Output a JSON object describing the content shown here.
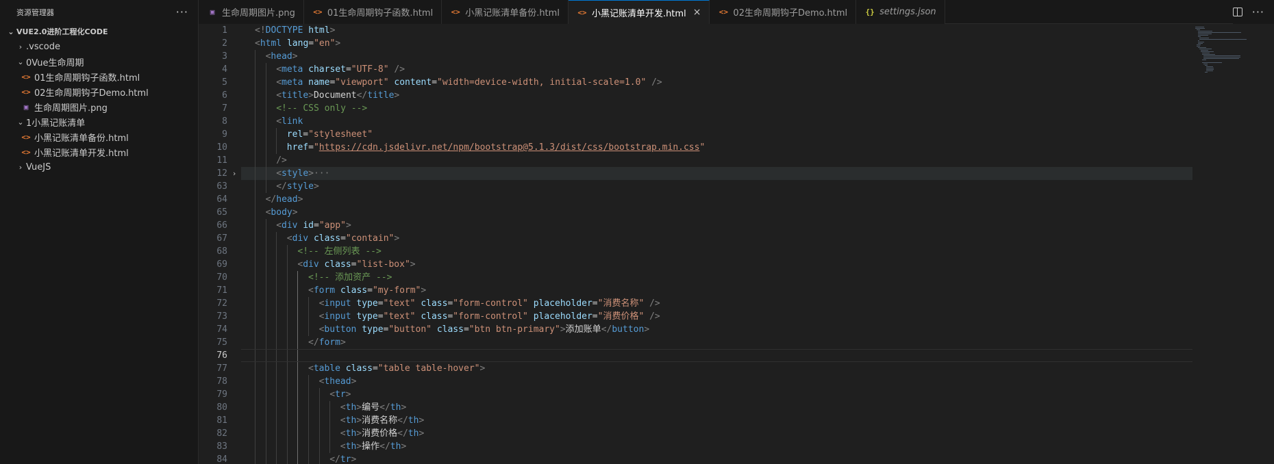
{
  "sidebar": {
    "title": "资源管理器",
    "more": "···",
    "root": "VUE2.0进阶工程化CODE",
    "tree": [
      {
        "label": ".vscode",
        "type": "folder",
        "open": false,
        "depth": 1
      },
      {
        "label": "0Vue生命周期",
        "type": "folder",
        "open": true,
        "depth": 1
      },
      {
        "label": "01生命周期钩子函数.html",
        "type": "html",
        "depth": 2
      },
      {
        "label": "02生命周期钩子Demo.html",
        "type": "html",
        "depth": 2
      },
      {
        "label": "生命周期图片.png",
        "type": "png",
        "depth": 2
      },
      {
        "label": "1小黑记账清单",
        "type": "folder",
        "open": true,
        "depth": 1
      },
      {
        "label": "小黑记账清单备份.html",
        "type": "html",
        "depth": 2
      },
      {
        "label": "小黑记账清单开发.html",
        "type": "html",
        "depth": 2
      },
      {
        "label": "VueJS",
        "type": "folder",
        "open": false,
        "depth": 1
      }
    ]
  },
  "tabs": [
    {
      "label": "生命周期图片.png",
      "type": "png"
    },
    {
      "label": "01生命周期钩子函数.html",
      "type": "html"
    },
    {
      "label": "小黑记账清单备份.html",
      "type": "html"
    },
    {
      "label": "小黑记账清单开发.html",
      "type": "html",
      "active": true,
      "close": "×"
    },
    {
      "label": "02生命周期钩子Demo.html",
      "type": "html"
    },
    {
      "label": "settings.json",
      "type": "json",
      "italic": true
    }
  ],
  "icons": {
    "html_glyph": "<>",
    "json_glyph": "{}",
    "png_glyph": "▣",
    "chevron_right": "›",
    "chevron_down": "⌄"
  },
  "editor": {
    "current_line": 76,
    "lines": [
      {
        "n": 1,
        "indent": 0,
        "tokens": [
          [
            "tg",
            "<!"
          ],
          [
            "tn",
            "DOCTYPE"
          ],
          [
            "tx",
            " "
          ],
          [
            "at",
            "html"
          ],
          [
            "tg",
            ">"
          ]
        ]
      },
      {
        "n": 2,
        "indent": 0,
        "tokens": [
          [
            "tg",
            "<"
          ],
          [
            "tn",
            "html"
          ],
          [
            "tx",
            " "
          ],
          [
            "at",
            "lang"
          ],
          [
            "tx",
            "="
          ],
          [
            "sv",
            "\"en\""
          ],
          [
            "tg",
            ">"
          ]
        ]
      },
      {
        "n": 3,
        "indent": 1,
        "tokens": [
          [
            "tg",
            "<"
          ],
          [
            "tn",
            "head"
          ],
          [
            "tg",
            ">"
          ]
        ]
      },
      {
        "n": 4,
        "indent": 2,
        "tokens": [
          [
            "tg",
            "<"
          ],
          [
            "tn",
            "meta"
          ],
          [
            "tx",
            " "
          ],
          [
            "at",
            "charset"
          ],
          [
            "tx",
            "="
          ],
          [
            "sv",
            "\"UTF-8\""
          ],
          [
            "tx",
            " "
          ],
          [
            "tg",
            "/>"
          ]
        ]
      },
      {
        "n": 5,
        "indent": 2,
        "tokens": [
          [
            "tg",
            "<"
          ],
          [
            "tn",
            "meta"
          ],
          [
            "tx",
            " "
          ],
          [
            "at",
            "name"
          ],
          [
            "tx",
            "="
          ],
          [
            "sv",
            "\"viewport\""
          ],
          [
            "tx",
            " "
          ],
          [
            "at",
            "content"
          ],
          [
            "tx",
            "="
          ],
          [
            "sv",
            "\"width=device-width, initial-scale=1.0\""
          ],
          [
            "tx",
            " "
          ],
          [
            "tg",
            "/>"
          ]
        ]
      },
      {
        "n": 6,
        "indent": 2,
        "tokens": [
          [
            "tg",
            "<"
          ],
          [
            "tn",
            "title"
          ],
          [
            "tg",
            ">"
          ],
          [
            "tx",
            "Document"
          ],
          [
            "tg",
            "</"
          ],
          [
            "tn",
            "title"
          ],
          [
            "tg",
            ">"
          ]
        ]
      },
      {
        "n": 7,
        "indent": 2,
        "tokens": [
          [
            "cm",
            "<!-- CSS only -->"
          ]
        ]
      },
      {
        "n": 8,
        "indent": 2,
        "tokens": [
          [
            "tg",
            "<"
          ],
          [
            "tn",
            "link"
          ]
        ]
      },
      {
        "n": 9,
        "indent": 3,
        "tokens": [
          [
            "at",
            "rel"
          ],
          [
            "tx",
            "="
          ],
          [
            "sv",
            "\"stylesheet\""
          ]
        ]
      },
      {
        "n": 10,
        "indent": 3,
        "tokens": [
          [
            "at",
            "href"
          ],
          [
            "tx",
            "="
          ],
          [
            "sv",
            "\""
          ],
          [
            "lk",
            "https://cdn.jsdelivr.net/npm/bootstrap@5.1.3/dist/css/bootstrap.min.css"
          ],
          [
            "sv",
            "\""
          ]
        ]
      },
      {
        "n": 11,
        "indent": 2,
        "tokens": [
          [
            "tg",
            "/>"
          ]
        ]
      },
      {
        "n": 12,
        "indent": 2,
        "fold": "›",
        "hl": true,
        "tokens": [
          [
            "tg",
            "<"
          ],
          [
            "tn",
            "style"
          ],
          [
            "tg",
            ">"
          ],
          [
            "ellip",
            "···"
          ]
        ]
      },
      {
        "n": 63,
        "indent": 2,
        "tokens": [
          [
            "tg",
            "</"
          ],
          [
            "tn",
            "style"
          ],
          [
            "tg",
            ">"
          ]
        ]
      },
      {
        "n": 64,
        "indent": 1,
        "tokens": [
          [
            "tg",
            "</"
          ],
          [
            "tn",
            "head"
          ],
          [
            "tg",
            ">"
          ]
        ]
      },
      {
        "n": 65,
        "indent": 1,
        "tokens": [
          [
            "tg",
            "<"
          ],
          [
            "tn",
            "body"
          ],
          [
            "tg",
            ">"
          ]
        ]
      },
      {
        "n": 66,
        "indent": 2,
        "tokens": [
          [
            "tg",
            "<"
          ],
          [
            "tn",
            "div"
          ],
          [
            "tx",
            " "
          ],
          [
            "at",
            "id"
          ],
          [
            "tx",
            "="
          ],
          [
            "sv",
            "\"app\""
          ],
          [
            "tg",
            ">"
          ]
        ]
      },
      {
        "n": 67,
        "indent": 3,
        "tokens": [
          [
            "tg",
            "<"
          ],
          [
            "tn",
            "div"
          ],
          [
            "tx",
            " "
          ],
          [
            "at",
            "class"
          ],
          [
            "tx",
            "="
          ],
          [
            "sv",
            "\"contain\""
          ],
          [
            "tg",
            ">"
          ]
        ]
      },
      {
        "n": 68,
        "indent": 4,
        "tokens": [
          [
            "cm",
            "<!-- 左侧列表 -->"
          ]
        ]
      },
      {
        "n": 69,
        "indent": 4,
        "tokens": [
          [
            "tg",
            "<"
          ],
          [
            "tn",
            "div"
          ],
          [
            "tx",
            " "
          ],
          [
            "at",
            "class"
          ],
          [
            "tx",
            "="
          ],
          [
            "sv",
            "\"list-box\""
          ],
          [
            "tg",
            ">"
          ]
        ]
      },
      {
        "n": 70,
        "indent": 5,
        "tokens": [
          [
            "cm",
            "<!-- 添加资产 -->"
          ]
        ]
      },
      {
        "n": 71,
        "indent": 5,
        "tokens": [
          [
            "tg",
            "<"
          ],
          [
            "tn",
            "form"
          ],
          [
            "tx",
            " "
          ],
          [
            "at",
            "class"
          ],
          [
            "tx",
            "="
          ],
          [
            "sv",
            "\"my-form\""
          ],
          [
            "tg",
            ">"
          ]
        ]
      },
      {
        "n": 72,
        "indent": 6,
        "tokens": [
          [
            "tg",
            "<"
          ],
          [
            "tn",
            "input"
          ],
          [
            "tx",
            " "
          ],
          [
            "at",
            "type"
          ],
          [
            "tx",
            "="
          ],
          [
            "sv",
            "\"text\""
          ],
          [
            "tx",
            " "
          ],
          [
            "at",
            "class"
          ],
          [
            "tx",
            "="
          ],
          [
            "sv",
            "\"form-control\""
          ],
          [
            "tx",
            " "
          ],
          [
            "at",
            "placeholder"
          ],
          [
            "tx",
            "="
          ],
          [
            "sv",
            "\"消费名称\""
          ],
          [
            "tx",
            " "
          ],
          [
            "tg",
            "/>"
          ]
        ]
      },
      {
        "n": 73,
        "indent": 6,
        "tokens": [
          [
            "tg",
            "<"
          ],
          [
            "tn",
            "input"
          ],
          [
            "tx",
            " "
          ],
          [
            "at",
            "type"
          ],
          [
            "tx",
            "="
          ],
          [
            "sv",
            "\"text\""
          ],
          [
            "tx",
            " "
          ],
          [
            "at",
            "class"
          ],
          [
            "tx",
            "="
          ],
          [
            "sv",
            "\"form-control\""
          ],
          [
            "tx",
            " "
          ],
          [
            "at",
            "placeholder"
          ],
          [
            "tx",
            "="
          ],
          [
            "sv",
            "\"消费价格\""
          ],
          [
            "tx",
            " "
          ],
          [
            "tg",
            "/>"
          ]
        ]
      },
      {
        "n": 74,
        "indent": 6,
        "tokens": [
          [
            "tg",
            "<"
          ],
          [
            "tn",
            "button"
          ],
          [
            "tx",
            " "
          ],
          [
            "at",
            "type"
          ],
          [
            "tx",
            "="
          ],
          [
            "sv",
            "\"button\""
          ],
          [
            "tx",
            " "
          ],
          [
            "at",
            "class"
          ],
          [
            "tx",
            "="
          ],
          [
            "sv",
            "\"btn btn-primary\""
          ],
          [
            "tg",
            ">"
          ],
          [
            "tx",
            "添加账单"
          ],
          [
            "tg",
            "</"
          ],
          [
            "tn",
            "button"
          ],
          [
            "tg",
            ">"
          ]
        ]
      },
      {
        "n": 75,
        "indent": 5,
        "tokens": [
          [
            "tg",
            "</"
          ],
          [
            "tn",
            "form"
          ],
          [
            "tg",
            ">"
          ]
        ]
      },
      {
        "n": 76,
        "indent": 0,
        "cur": true,
        "tokens": []
      },
      {
        "n": 77,
        "indent": 5,
        "tokens": [
          [
            "tg",
            "<"
          ],
          [
            "tn",
            "table"
          ],
          [
            "tx",
            " "
          ],
          [
            "at",
            "class"
          ],
          [
            "tx",
            "="
          ],
          [
            "sv",
            "\"table table-hover\""
          ],
          [
            "tg",
            ">"
          ]
        ]
      },
      {
        "n": 78,
        "indent": 6,
        "tokens": [
          [
            "tg",
            "<"
          ],
          [
            "tn",
            "thead"
          ],
          [
            "tg",
            ">"
          ]
        ]
      },
      {
        "n": 79,
        "indent": 7,
        "tokens": [
          [
            "tg",
            "<"
          ],
          [
            "tn",
            "tr"
          ],
          [
            "tg",
            ">"
          ]
        ]
      },
      {
        "n": 80,
        "indent": 8,
        "tokens": [
          [
            "tg",
            "<"
          ],
          [
            "tn",
            "th"
          ],
          [
            "tg",
            ">"
          ],
          [
            "tx",
            "编号"
          ],
          [
            "tg",
            "</"
          ],
          [
            "tn",
            "th"
          ],
          [
            "tg",
            ">"
          ]
        ]
      },
      {
        "n": 81,
        "indent": 8,
        "tokens": [
          [
            "tg",
            "<"
          ],
          [
            "tn",
            "th"
          ],
          [
            "tg",
            ">"
          ],
          [
            "tx",
            "消费名称"
          ],
          [
            "tg",
            "</"
          ],
          [
            "tn",
            "th"
          ],
          [
            "tg",
            ">"
          ]
        ]
      },
      {
        "n": 82,
        "indent": 8,
        "tokens": [
          [
            "tg",
            "<"
          ],
          [
            "tn",
            "th"
          ],
          [
            "tg",
            ">"
          ],
          [
            "tx",
            "消费价格"
          ],
          [
            "tg",
            "</"
          ],
          [
            "tn",
            "th"
          ],
          [
            "tg",
            ">"
          ]
        ]
      },
      {
        "n": 83,
        "indent": 8,
        "tokens": [
          [
            "tg",
            "<"
          ],
          [
            "tn",
            "th"
          ],
          [
            "tg",
            ">"
          ],
          [
            "tx",
            "操作"
          ],
          [
            "tg",
            "</"
          ],
          [
            "tn",
            "th"
          ],
          [
            "tg",
            ">"
          ]
        ]
      },
      {
        "n": 84,
        "indent": 7,
        "tokens": [
          [
            "tg",
            "</"
          ],
          [
            "tn",
            "tr"
          ],
          [
            "tg",
            ">"
          ]
        ]
      }
    ]
  }
}
